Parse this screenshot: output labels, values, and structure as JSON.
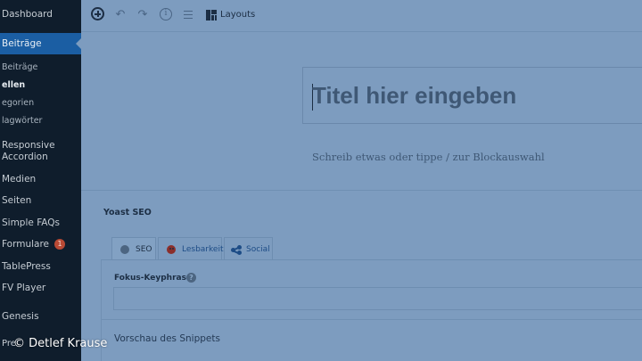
{
  "sidebar": {
    "dashboard": "Dashboard",
    "active_section": "Beiträge",
    "sub_items": [
      {
        "label": "Beiträge",
        "current": false
      },
      {
        "label": "ellen",
        "current": true
      },
      {
        "label": "egorien",
        "current": false
      },
      {
        "label": "lagwörter",
        "current": false
      }
    ],
    "items": [
      {
        "label": "Responsive Accordion"
      },
      {
        "label": "Medien"
      },
      {
        "label": "Seiten"
      },
      {
        "label": "Simple FAQs"
      },
      {
        "label": "Formulare",
        "badge": "1"
      },
      {
        "label": "TablePress"
      },
      {
        "label": "FV Player"
      },
      {
        "label": "Genesis"
      }
    ],
    "cut_item": "Pre"
  },
  "toolbar": {
    "add_icon": "plus-circle-icon",
    "undo_glyph": "↶",
    "redo_glyph": "↷",
    "info_glyph": "i",
    "layouts_label": "Layouts"
  },
  "editor": {
    "title_placeholder": "Titel hier eingeben",
    "body_placeholder": "Schreib etwas oder tippe / zur Blockauswahl"
  },
  "yoast": {
    "title": "Yoast SEO",
    "tabs": [
      {
        "label": "SEO",
        "icon": "grey-dot-icon",
        "active": true
      },
      {
        "label": "Lesbarkeit",
        "icon": "sad-face-icon",
        "active": false
      },
      {
        "label": "Social",
        "icon": "share-icon",
        "active": false
      }
    ],
    "keyphrase_label": "Fokus-Keyphrase",
    "help_glyph": "?",
    "snippet_label": "Vorschau des Snippets"
  },
  "watermark": "© Detlef Krause",
  "colors": {
    "sidebar_bg": "#0f1d2c",
    "sidebar_active": "#1b5ea3",
    "canvas_overlay": "#7d9cbf",
    "badge": "#b94a35"
  }
}
